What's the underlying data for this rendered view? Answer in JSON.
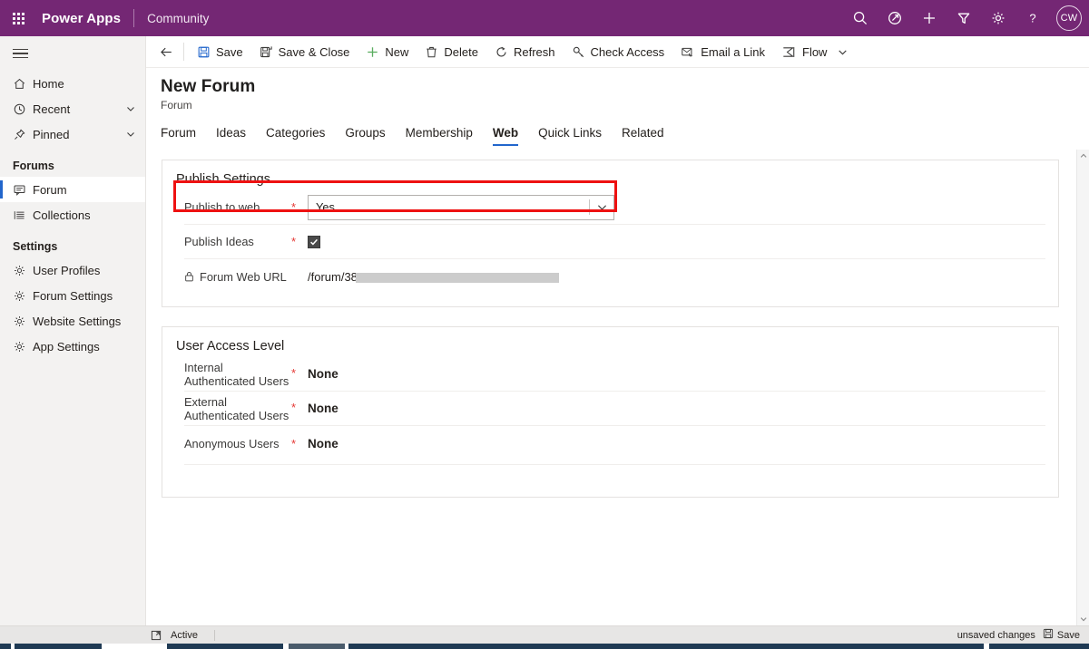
{
  "topbar": {
    "waffle": "app-launcher",
    "brand": "Power Apps",
    "environment": "Community",
    "icons": [
      "search-icon",
      "assistant-icon",
      "new-icon",
      "filter-icon",
      "settings-gear-icon",
      "help-icon"
    ],
    "avatar_initials": "CW"
  },
  "sidebar": {
    "hamburger": "menu",
    "items": [
      {
        "label": "Home",
        "icon": "home-icon",
        "chevron": false
      },
      {
        "label": "Recent",
        "icon": "clock-icon",
        "chevron": true
      },
      {
        "label": "Pinned",
        "icon": "pin-icon",
        "chevron": true
      }
    ],
    "groups": [
      {
        "title": "Forums",
        "items": [
          {
            "label": "Forum",
            "icon": "speech-bubble-icon",
            "selected": true
          },
          {
            "label": "Collections",
            "icon": "list-icon",
            "selected": false
          }
        ]
      },
      {
        "title": "Settings",
        "items": [
          {
            "label": "User Profiles",
            "icon": "gear-icon",
            "selected": false
          },
          {
            "label": "Forum Settings",
            "icon": "gear-icon",
            "selected": false
          },
          {
            "label": "Website Settings",
            "icon": "gear-icon",
            "selected": false
          },
          {
            "label": "App Settings",
            "icon": "gear-icon",
            "selected": false
          }
        ]
      }
    ]
  },
  "commandbar": {
    "back": "back-arrow",
    "buttons": [
      {
        "label": "Save",
        "icon": "save-floppy-icon"
      },
      {
        "label": "Save & Close",
        "icon": "save-close-icon"
      },
      {
        "label": "New",
        "icon": "plus-icon"
      },
      {
        "label": "Delete",
        "icon": "trash-icon"
      },
      {
        "label": "Refresh",
        "icon": "refresh-icon"
      },
      {
        "label": "Check Access",
        "icon": "key-icon"
      },
      {
        "label": "Email a Link",
        "icon": "email-link-icon"
      },
      {
        "label": "Flow",
        "icon": "flow-icon",
        "has_chevron": true
      }
    ]
  },
  "record": {
    "title": "New Forum",
    "subtitle": "Forum",
    "tabs": [
      {
        "label": "Forum",
        "active": false
      },
      {
        "label": "Ideas",
        "active": false
      },
      {
        "label": "Categories",
        "active": false
      },
      {
        "label": "Groups",
        "active": false
      },
      {
        "label": "Membership",
        "active": false
      },
      {
        "label": "Web",
        "active": true
      },
      {
        "label": "Quick Links",
        "active": false
      },
      {
        "label": "Related",
        "active": false
      }
    ]
  },
  "publish_settings": {
    "title": "Publish Settings",
    "publish_to_web": {
      "label": "Publish to web",
      "required": "*",
      "value": "Yes",
      "chevron": "chevron-down-icon"
    },
    "publish_ideas": {
      "label": "Publish Ideas",
      "required": "*",
      "checked": true
    },
    "forum_web_url": {
      "label": "Forum Web URL",
      "lock": "lock-icon",
      "value": "/forum/38",
      "redacted": true
    }
  },
  "user_access_level": {
    "title": "User Access Level",
    "rows": [
      {
        "label": "Internal\nAuthenticated Users",
        "label_line1": "Internal",
        "label_line2": "Authenticated Users",
        "required": "*",
        "value": "None"
      },
      {
        "label": "External\nAuthenticated Users",
        "label_line1": "External",
        "label_line2": "Authenticated Users",
        "required": "*",
        "value": "None"
      },
      {
        "label": "Anonymous Users",
        "label_line1": "Anonymous Users",
        "label_line2": "",
        "required": "*",
        "value": "None"
      }
    ]
  },
  "statusbar": {
    "expand_icon": "expand-icon",
    "status": "Active",
    "unsaved": "unsaved changes",
    "save_label": "Save",
    "save_icon": "save-floppy-icon"
  },
  "annotation": {
    "type": "red-highlight-rectangle",
    "target": "publish-to-web-row",
    "color": "#ee1111"
  },
  "colors": {
    "brand_purple": "#742774",
    "accent_blue": "#2266cc",
    "required_red": "#e53935",
    "sidebar_bg": "#f3f2f1"
  }
}
